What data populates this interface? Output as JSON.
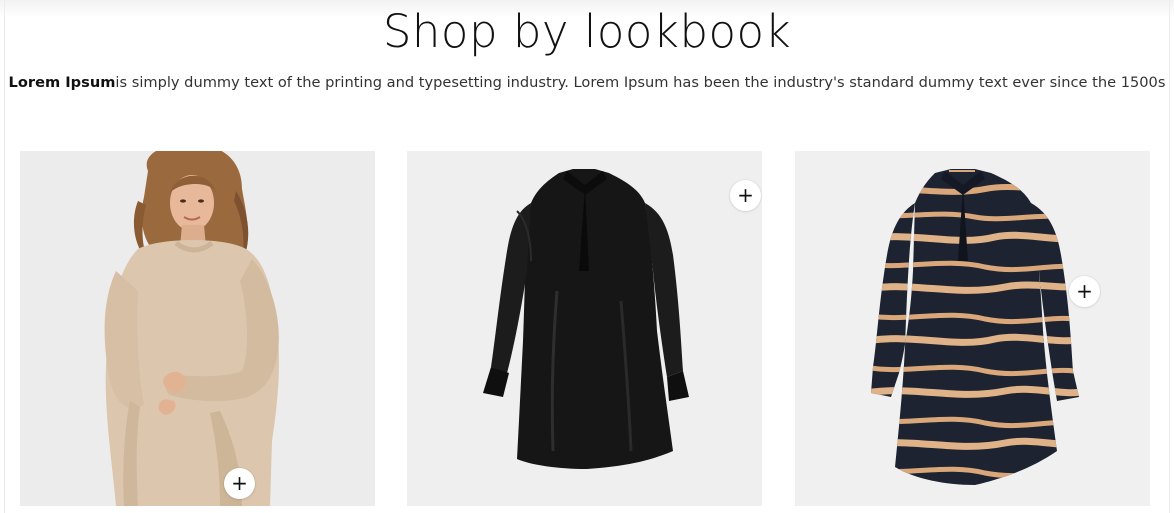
{
  "section": {
    "title": "Shop by lookbook",
    "description_bold": "Lorem Ipsum",
    "description_rest": "is simply dummy text of the printing and typesetting industry. Lorem Ipsum has been the industry's standard dummy text ever since the 1500s"
  },
  "lookbook": [
    {
      "image": "beige-sweatshirt-dress-model-photo",
      "hotspot_icon": "plus-icon",
      "hotspot_label": "+"
    },
    {
      "image": "black-satin-tunic-dress-photo",
      "hotspot_icon": "plus-icon",
      "hotspot_label": "+"
    },
    {
      "image": "navy-zebra-print-tunic-dress-photo",
      "hotspot_icon": "plus-icon",
      "hotspot_label": "+"
    }
  ],
  "colors": {
    "card_background": "#eeeeee",
    "beige_dress": "#dcc6ad",
    "black_dress": "#151515",
    "navy_dress": "#1d2330",
    "stripe": "#d9a77a"
  }
}
